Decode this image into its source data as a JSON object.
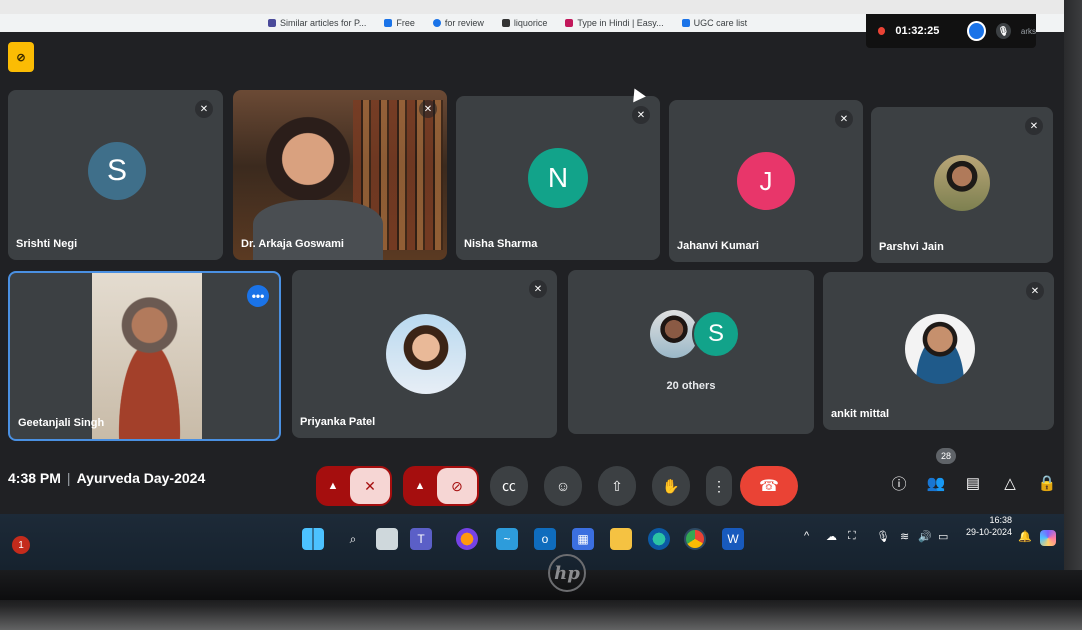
{
  "browser": {
    "bookmarks": [
      {
        "label": "Similar articles for P...",
        "color": "#4a4a9a"
      },
      {
        "label": "Free",
        "color": "#1a73e8"
      },
      {
        "label": "for review",
        "color": "#1a73e8"
      },
      {
        "label": "liquorice",
        "color": "#333333"
      },
      {
        "label": "Type in Hindi | Easy...",
        "color": "#c2185b"
      },
      {
        "label": "UGC care list",
        "color": "#1a73e8"
      }
    ]
  },
  "recording": {
    "time": "01:32:25",
    "bookmarks_tail": "arks"
  },
  "participants_row1": [
    {
      "name": "Srishti Negi",
      "initial": "S",
      "avatar_color": "#3f6f8a",
      "muted": true
    },
    {
      "name": "Dr. Arkaja Goswami",
      "initial": "",
      "video": true,
      "muted": true
    },
    {
      "name": "Nisha Sharma",
      "initial": "N",
      "avatar_color": "#12a38a",
      "muted": true
    },
    {
      "name": "Jahanvi Kumari",
      "initial": "J",
      "avatar_color": "#e8366a",
      "muted": true
    },
    {
      "name": "Parshvi Jain",
      "initial": "",
      "photo": true,
      "muted": true
    }
  ],
  "participants_row2": [
    {
      "name": "Geetanjali Singh",
      "video": true,
      "active": true,
      "more_label": "•••"
    },
    {
      "name": "Priyanka Patel",
      "photo": true,
      "muted": true
    },
    {
      "name": "20 others",
      "initial": "S",
      "avatar_color": "#12a38a"
    },
    {
      "name": "ankit mittal",
      "photo": true,
      "muted": true
    }
  ],
  "meeting": {
    "time": "4:38 PM",
    "title": "Ayurveda Day-2024",
    "participant_count": "28"
  },
  "controls": {
    "mic_off_icon": "mic-off-icon",
    "cam_off_icon": "camera-off-icon",
    "captions_icon": "captions-icon",
    "emoji_icon": "emoji-icon",
    "present_icon": "present-icon",
    "raise_hand_icon": "raise-hand-icon",
    "more_icon": "more-options-icon",
    "end_call_icon": "end-call-icon"
  },
  "taskbar": {
    "time": "16:38",
    "date": "29-10-2024",
    "notification_count": "1"
  },
  "device": {
    "brand": "hp"
  }
}
